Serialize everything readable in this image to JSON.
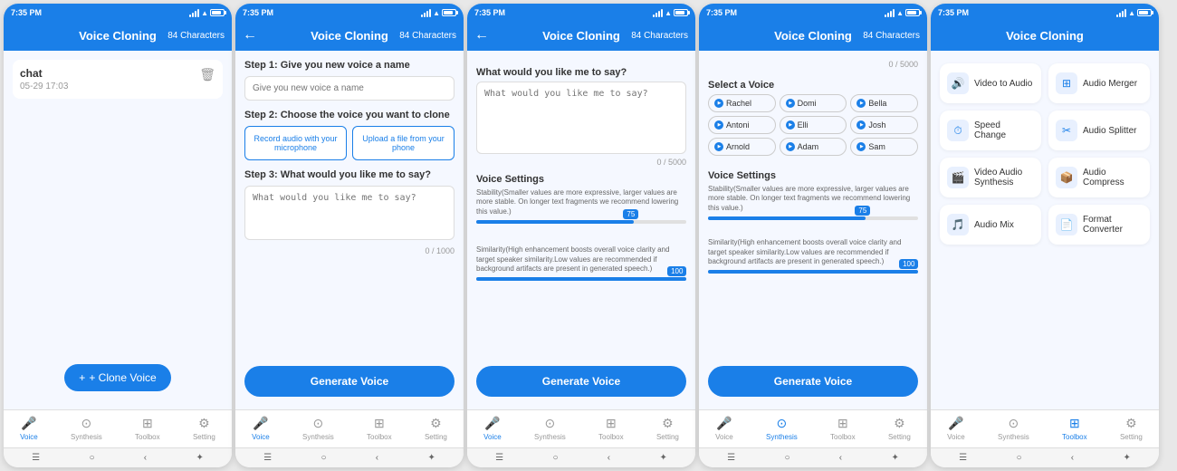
{
  "screens": [
    {
      "id": "screen1",
      "status_time": "7:35 PM",
      "header_title": "Voice Cloning",
      "char_count": "84 Characters",
      "has_back": false,
      "content_type": "chat",
      "chat": {
        "name": "chat",
        "date": "05-29 17:03"
      },
      "clone_button": "+ Clone Voice",
      "nav": {
        "items": [
          "Voice",
          "Synthesis",
          "Toolbox",
          "Setting"
        ],
        "active": 0
      }
    },
    {
      "id": "screen2",
      "status_time": "7:35 PM",
      "header_title": "Voice Cloning",
      "char_count": "84 Characters",
      "has_back": true,
      "content_type": "clone_setup",
      "step1_title": "Step 1: Give you new voice a name",
      "step1_placeholder": "Give you new voice a name",
      "step2_title": "Step 2: Choose the voice you want to clone",
      "btn1": "Record audio with your microphone",
      "btn2": "Upload a file from your phone",
      "step3_title": "Step 3: What would you like me to say?",
      "step3_placeholder": "What would you like me to say?",
      "char_counter": "0 / 1000",
      "generate_label": "Generate Voice",
      "nav": {
        "items": [
          "Voice",
          "Synthesis",
          "Toolbox",
          "Setting"
        ],
        "active": 0
      }
    },
    {
      "id": "screen3",
      "status_time": "7:35 PM",
      "header_title": "Voice Cloning",
      "char_count": "84 Characters",
      "has_back": true,
      "content_type": "say_something",
      "say_title": "What would you like me to say?",
      "say_placeholder": "What would you like me to say?",
      "char_counter": "0 / 5000",
      "voice_settings_title": "Voice Settings",
      "stability_desc": "Stability(Smaller values are more expressive, larger values are more stable. On longer text fragments we recommend lowering this value.)",
      "stability_val": 75,
      "similarity_desc": "Similarity(High enhancement boosts overall voice clarity and target speaker similarity.Low values are recommended if background artifacts are present in generated speech.)",
      "similarity_val": 100,
      "generate_label": "Generate Voice",
      "nav": {
        "items": [
          "Voice",
          "Synthesis",
          "Toolbox",
          "Setting"
        ],
        "active": 0
      }
    },
    {
      "id": "screen4",
      "status_time": "7:35 PM",
      "header_title": "Voice Cloning",
      "char_count": "84 Characters",
      "has_back": false,
      "content_type": "synthesis",
      "select_voice_title": "Select a Voice",
      "voices": [
        "Rachel",
        "Domi",
        "Bella",
        "Antoni",
        "Elli",
        "Josh",
        "Arnold",
        "Adam",
        "Sam"
      ],
      "voice_settings_title": "Voice Settings",
      "stability_desc": "Stability(Smaller values are more expressive, larger values are more stable. On longer text fragments we recommend lowering this value.)",
      "stability_val": 75,
      "similarity_desc": "Similarity(High enhancement boosts overall voice clarity and target speaker similarity.Low values are recommended if background artifacts are present in generated speech.)",
      "similarity_val": 100,
      "generate_label": "Generate Voice",
      "nav": {
        "items": [
          "Voice",
          "Synthesis",
          "Toolbox",
          "Setting"
        ],
        "active": 1
      }
    },
    {
      "id": "screen5",
      "status_time": "7:35 PM",
      "header_title": "Voice Cloning",
      "has_back": false,
      "content_type": "toolbox",
      "tools": [
        {
          "icon": "🔊",
          "label": "Video to Audio"
        },
        {
          "icon": "⊞",
          "label": "Audio Merger"
        },
        {
          "icon": "⏱",
          "label": "Speed Change"
        },
        {
          "icon": "✂",
          "label": "Audio Splitter"
        },
        {
          "icon": "🎬",
          "label": "Video Audio Synthesis"
        },
        {
          "icon": "📦",
          "label": "Audio Compress"
        },
        {
          "icon": "🎵",
          "label": "Audio Mix"
        },
        {
          "icon": "📄",
          "label": "Format Converter"
        }
      ],
      "nav": {
        "items": [
          "Voice",
          "Synthesis",
          "Toolbox",
          "Setting"
        ],
        "active": 2
      }
    }
  ]
}
